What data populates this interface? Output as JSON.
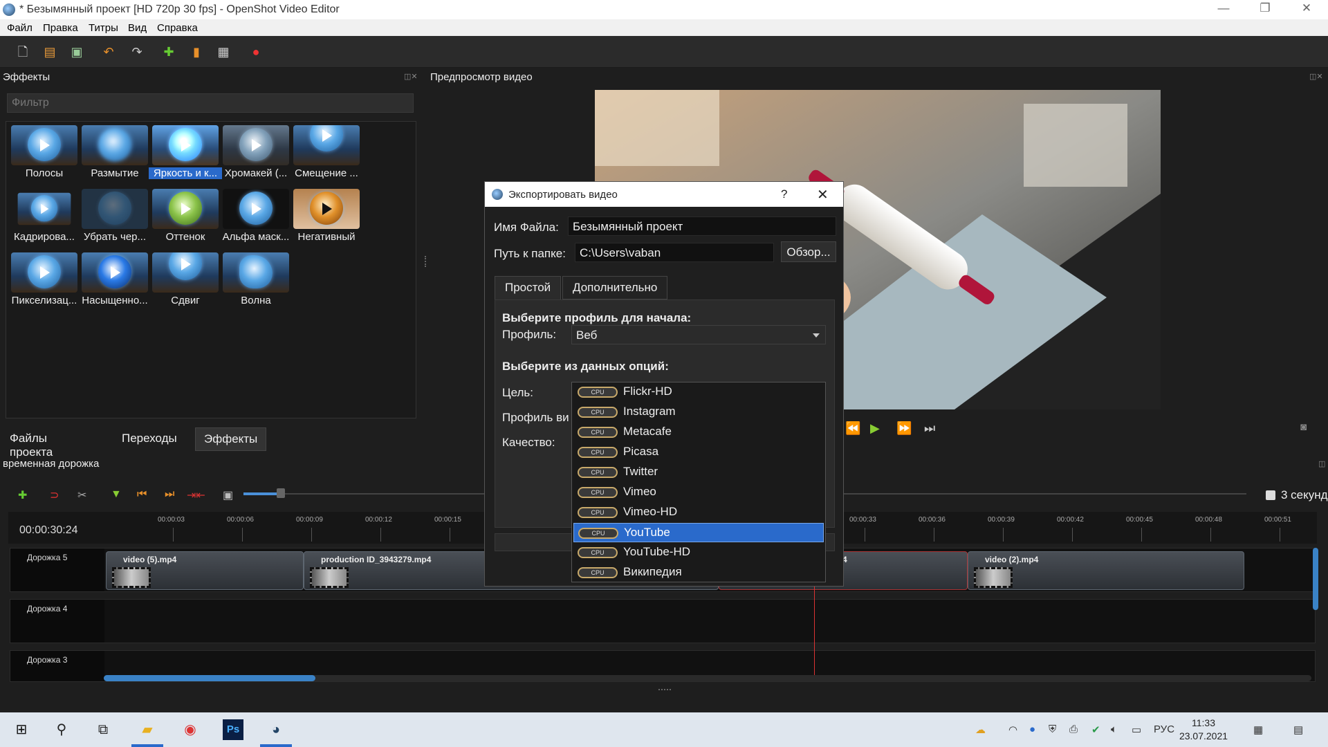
{
  "window": {
    "title": "* Безымянный проект [HD 720p 30 fps] - OpenShot Video Editor"
  },
  "menu": [
    "Файл",
    "Правка",
    "Титры",
    "Вид",
    "Справка"
  ],
  "effects_panel": {
    "title": "Эффекты",
    "filter_placeholder": "Фильтр",
    "items": [
      "Полосы",
      "Размытие",
      "Яркость и к...",
      "Хромакей (...",
      "Смещение ...",
      "Кадрирова...",
      "Убрать чер...",
      "Оттенок",
      "Альфа маск...",
      "Негативный",
      "Пикселизац...",
      "Насыщенно...",
      "Сдвиг",
      "Волна"
    ],
    "selected": "Яркость и к..."
  },
  "bottom_tabs": [
    "Файлы проекта",
    "Переходы",
    "Эффекты"
  ],
  "preview": {
    "title": "Предпросмотр видео"
  },
  "timeline": {
    "title": "временная дорожка",
    "timecode": "00:00:30:24",
    "zoom_label": "3 секунд",
    "ticks": [
      "00:00:03",
      "00:00:06",
      "00:00:09",
      "00:00:12",
      "00:00:15",
      "00:00:33",
      "00:00:36",
      "00:00:39",
      "00:00:42",
      "00:00:45",
      "00:00:48",
      "00:00:51"
    ],
    "tracks": [
      {
        "name": "Дорожка 5",
        "clips": [
          "video (5).mp4",
          "production ID_3943279.mp4",
          "mp4",
          "video (2).mp4"
        ]
      },
      {
        "name": "Дорожка 4",
        "clips": []
      },
      {
        "name": "Дорожка 3",
        "clips": []
      }
    ]
  },
  "export_dialog": {
    "title": "Экспортировать видео",
    "help": "?",
    "close": "✕",
    "filename_label": "Имя Файла:",
    "filename_value": "Безымянный проект",
    "folder_label": "Путь к папке:",
    "folder_value": "C:\\Users\\vaban",
    "browse_button": "Обзор...",
    "tabs": [
      "Простой",
      "Дополнительно"
    ],
    "profile_heading": "Выберите профиль для начала:",
    "profile_label": "Профиль:",
    "profile_value": "Веб",
    "options_heading": "Выберите из данных опций:",
    "target_label": "Цель:",
    "video_profile_label": "Профиль ви",
    "quality_label": "Качество:",
    "target_options": [
      "Flickr-HD",
      "Instagram",
      "Metacafe",
      "Picasa",
      "Twitter",
      "Vimeo",
      "Vimeo-HD",
      "YouTube",
      "YouTube-HD",
      "Википедия"
    ],
    "target_selected": "YouTube",
    "cpu_badge": "CPU"
  },
  "taskbar": {
    "lang": "РУС",
    "time": "11:33",
    "date": "23.07.2021"
  },
  "colors": {
    "accent": "#2a6acb",
    "playhead": "#dd3333"
  }
}
